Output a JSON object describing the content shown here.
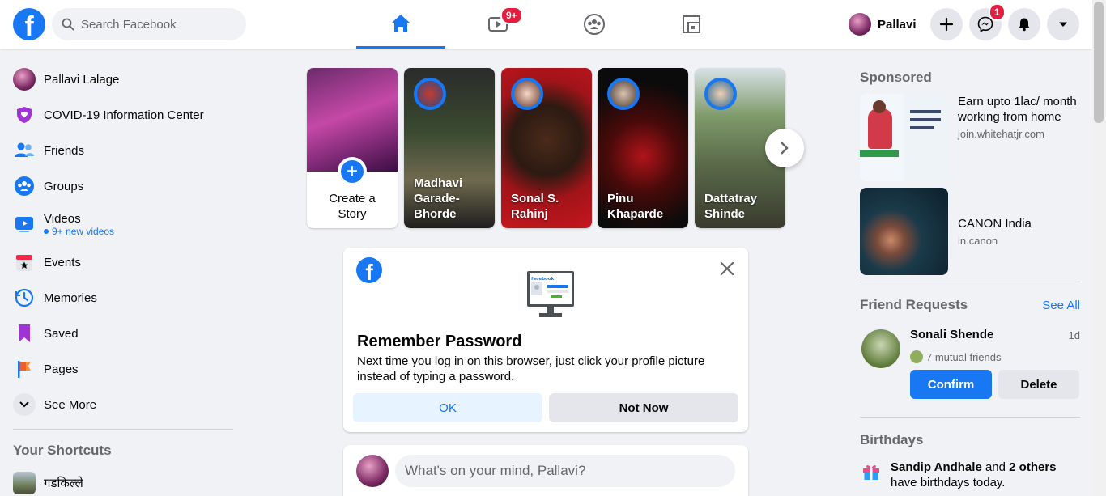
{
  "topbar": {
    "search_placeholder": "Search Facebook",
    "watch_badge": "9+",
    "profile_name": "Pallavi",
    "messenger_badge": "1"
  },
  "sidebar": {
    "items": [
      {
        "label": "Pallavi Lalage"
      },
      {
        "label": "COVID-19 Information Center"
      },
      {
        "label": "Friends"
      },
      {
        "label": "Groups"
      },
      {
        "label": "Videos",
        "sub": "9+ new videos"
      },
      {
        "label": "Events"
      },
      {
        "label": "Memories"
      },
      {
        "label": "Saved"
      },
      {
        "label": "Pages"
      },
      {
        "label": "See More"
      }
    ],
    "shortcuts_title": "Your Shortcuts",
    "shortcuts": [
      {
        "label": "गडकिल्ले"
      }
    ]
  },
  "stories": {
    "create_label_1": "Create a",
    "create_label_2": "Story",
    "items": [
      {
        "name_1": "Madhavi",
        "name_2": "Garade-",
        "name_3": "Bhorde"
      },
      {
        "name_1": "Sonal S.",
        "name_2": "Rahinj"
      },
      {
        "name_1": "Pinu",
        "name_2": "Khaparde"
      },
      {
        "name_1": "Dattatray",
        "name_2": "Shinde"
      }
    ]
  },
  "remember_password": {
    "title": "Remember Password",
    "description": "Next time you log in on this browser, just click your profile picture instead of typing a password.",
    "ok_label": "OK",
    "not_now_label": "Not Now",
    "monitor_brand": "facebook"
  },
  "composer": {
    "placeholder": "What's on your mind, Pallavi?"
  },
  "right": {
    "sponsored_title": "Sponsored",
    "ads": [
      {
        "title": "Earn upto 1lac/ month working from home",
        "domain": "join.whitehatjr.com"
      },
      {
        "title": "CANON India",
        "domain": "in.canon"
      }
    ],
    "friend_requests": {
      "title": "Friend Requests",
      "see_all": "See All",
      "name": "Sonali Shende",
      "time": "1d",
      "mutual": "7 mutual friends",
      "confirm_label": "Confirm",
      "delete_label": "Delete"
    },
    "birthdays": {
      "title": "Birthdays",
      "name": "Sandip Andhale",
      "and": " and ",
      "others": "2 others",
      "rest": " have birthdays today."
    }
  },
  "colors": {
    "brand": "#1877f2",
    "background": "#f0f2f5",
    "badge": "#e41e3f"
  }
}
